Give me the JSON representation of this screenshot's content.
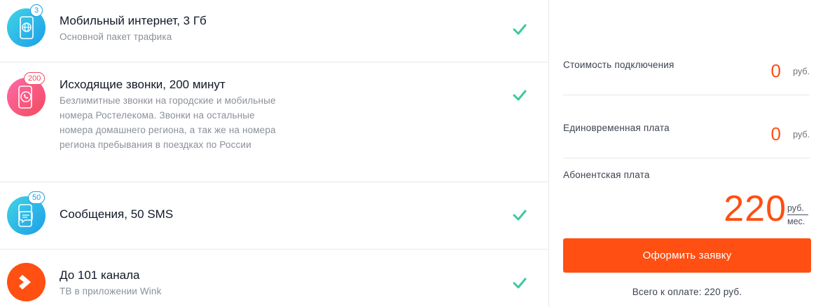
{
  "services": [
    {
      "icon": "globe-phone-icon",
      "badge": "3",
      "title": "Мобильный интернет, 3 Гб",
      "subtitle": "Основной пакет трафика"
    },
    {
      "icon": "phone-call-icon",
      "badge": "200",
      "title": "Исходящие звонки, 200 минут",
      "subtitle": "Безлимитные звонки на городские и мобильные номера Ростелекома. Звонки на остальные номера домашнего региона, а так же на номера региона пребывания в поездках по России"
    },
    {
      "icon": "message-icon",
      "badge": "50",
      "title": "Сообщения, 50 SMS",
      "subtitle": ""
    },
    {
      "icon": "wink-logo-icon",
      "badge": "",
      "title": "До 101 канала",
      "subtitle": "ТВ в приложении Wink"
    }
  ],
  "pricing": {
    "connection_label": "Стоимость подключения",
    "connection_value": "0",
    "connection_currency": "руб.",
    "onetime_label": "Единовременная плата",
    "onetime_value": "0",
    "onetime_currency": "руб.",
    "subscription_label": "Абонентская плата",
    "subscription_value": "220",
    "subscription_unit_top": "руб.",
    "subscription_unit_bottom": "мес."
  },
  "order_button_label": "Оформить заявку",
  "total_text": "Всего к оплате: 220 руб.",
  "colors": {
    "accent": "#ff4f12",
    "check": "#3cc9a0",
    "cyan": "#1c9ee8",
    "pink": "#f34a5e"
  }
}
